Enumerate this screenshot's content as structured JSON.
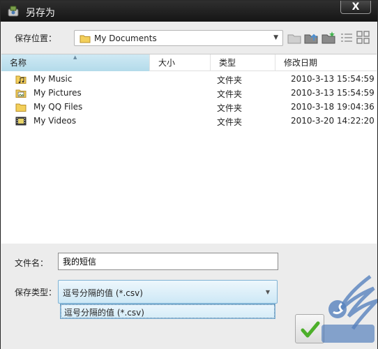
{
  "window": {
    "title": "另存为",
    "close_label": "X"
  },
  "toolbar": {
    "save_in_label": "保存位置：",
    "location_value": "My Documents"
  },
  "list": {
    "columns": {
      "name": "名称",
      "size": "大小",
      "type": "类型",
      "date": "修改日期"
    },
    "rows": [
      {
        "name": "My Music",
        "type": "文件夹",
        "date": "2010-3-13 15:54:59",
        "icon": "music-folder-icon"
      },
      {
        "name": "My Pictures",
        "type": "文件夹",
        "date": "2010-3-13 15:54:59",
        "icon": "pictures-folder-icon"
      },
      {
        "name": "My QQ Files",
        "type": "文件夹",
        "date": "2010-3-18 19:04:36",
        "icon": "folder-icon"
      },
      {
        "name": "My Videos",
        "type": "文件夹",
        "date": "2010-3-20 14:22:20",
        "icon": "video-folder-icon"
      }
    ]
  },
  "form": {
    "filename_label": "文件名：",
    "filename_value": "我的短信",
    "filetype_label": "保存类型：",
    "filetype_value": "逗号分隔的值 (*.csv)",
    "filetype_options": [
      "逗号分隔的值 (*.csv)"
    ]
  },
  "colors": {
    "titlebar": "#1c1c1c",
    "header_sorted": "#c3e3f0",
    "accent": "#7fb2d4",
    "ok_check": "#4caf2a"
  }
}
